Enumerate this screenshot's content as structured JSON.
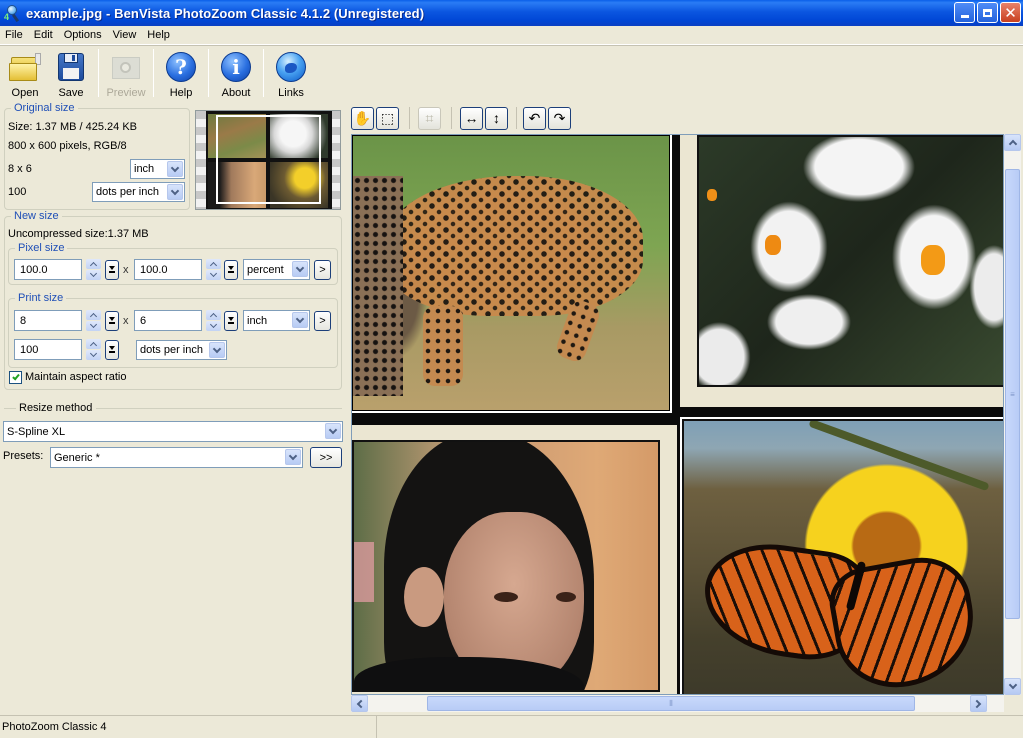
{
  "window": {
    "title": "example.jpg - BenVista PhotoZoom Classic 4.1.2 (Unregistered)",
    "app_icon": "photozoom-magnifier-icon",
    "buttons": [
      "minimize",
      "restore",
      "close"
    ]
  },
  "menu": [
    "File",
    "Edit",
    "Options",
    "View",
    "Help"
  ],
  "toolbar": {
    "open": "Open",
    "save": "Save",
    "preview": "Preview",
    "help": "Help",
    "about": "About",
    "links": "Links"
  },
  "original_size": {
    "legend": "Original size",
    "size": "Size: 1.37 MB / 425.24 KB",
    "pixels": "800 x 600 pixels, RGB/8",
    "print_dims": "8 x 6",
    "print_unit": "inch",
    "resolution": "100",
    "resolution_unit": "dots per inch"
  },
  "new_size": {
    "legend": "New size",
    "uncompressed": "Uncompressed size:1.37 MB",
    "pixel_size": {
      "legend": "Pixel size",
      "width": "100.0",
      "height": "100.0",
      "separator": "x",
      "unit": "percent",
      "more_button": ">"
    },
    "print_size": {
      "legend": "Print size",
      "width": "8",
      "height": "6",
      "separator": "x",
      "unit": "inch",
      "more_button": ">",
      "resolution": "100",
      "resolution_unit": "dots per inch"
    },
    "maintain_aspect": {
      "label": "Maintain aspect ratio",
      "checked": true
    }
  },
  "resize": {
    "legend": "Resize method",
    "method": "S-Spline XL",
    "presets_label": "Presets:",
    "preset": "Generic *",
    "presets_button": ">>"
  },
  "viewer_tools": [
    {
      "name": "hand-tool",
      "glyph": "✋"
    },
    {
      "name": "select-tool",
      "glyph": "⬚"
    },
    {
      "name": "crop-tool",
      "glyph": "⌗",
      "disabled": true
    },
    {
      "name": "fit-width",
      "glyph": "↔"
    },
    {
      "name": "fit-height",
      "glyph": "↕"
    },
    {
      "name": "rotate-left",
      "glyph": "↶"
    },
    {
      "name": "rotate-right",
      "glyph": "↷"
    }
  ],
  "image_tiles": [
    "jaguar",
    "white crocus flowers",
    "woman portrait",
    "monarch butterfly on yellow flower"
  ],
  "scroll": {
    "vertical_thumb_fraction": 0.88,
    "horizontal_thumb_fraction": 0.81
  },
  "status": {
    "text": "PhotoZoom Classic 4"
  }
}
